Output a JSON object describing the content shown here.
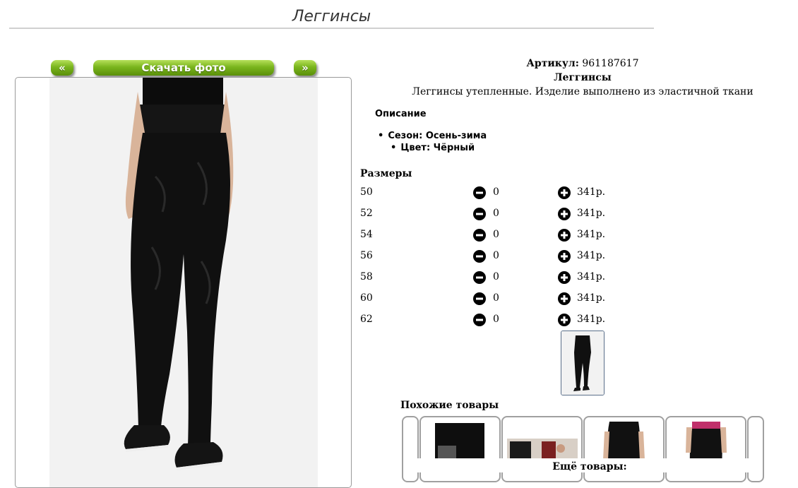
{
  "page": {
    "title": "Леггинсы"
  },
  "gallery": {
    "prev_label": "«",
    "download_label": "Скачать фото",
    "next_label": "»"
  },
  "product": {
    "article_label": "Артикул:",
    "article_value": "961187617",
    "name": "Леггинсы",
    "short_description": "Леггинсы утепленные. Изделие выполнено из эластичной ткани",
    "description_heading": "Описание",
    "attributes": [
      {
        "text": "Сезон: Осень-зима"
      },
      {
        "text": "Цвет: Чёрный"
      }
    ]
  },
  "sizes": {
    "heading": "Размеры",
    "rows": [
      {
        "size": "50",
        "qty": "0",
        "price": "341р."
      },
      {
        "size": "52",
        "qty": "0",
        "price": "341р."
      },
      {
        "size": "54",
        "qty": "0",
        "price": "341р."
      },
      {
        "size": "56",
        "qty": "0",
        "price": "341р."
      },
      {
        "size": "58",
        "qty": "0",
        "price": "341р."
      },
      {
        "size": "60",
        "qty": "0",
        "price": "341р."
      },
      {
        "size": "62",
        "qty": "0",
        "price": "341р."
      }
    ]
  },
  "similar": {
    "heading": "Похожие товары",
    "more_label": "Ещё товары:"
  },
  "colors": {
    "button_green": "#7ab51d",
    "frame_border": "#9a9a9a",
    "thumb_border": "#5a6f8a"
  },
  "icons": {
    "minus": "minus-circle-icon",
    "plus": "plus-circle-icon"
  }
}
